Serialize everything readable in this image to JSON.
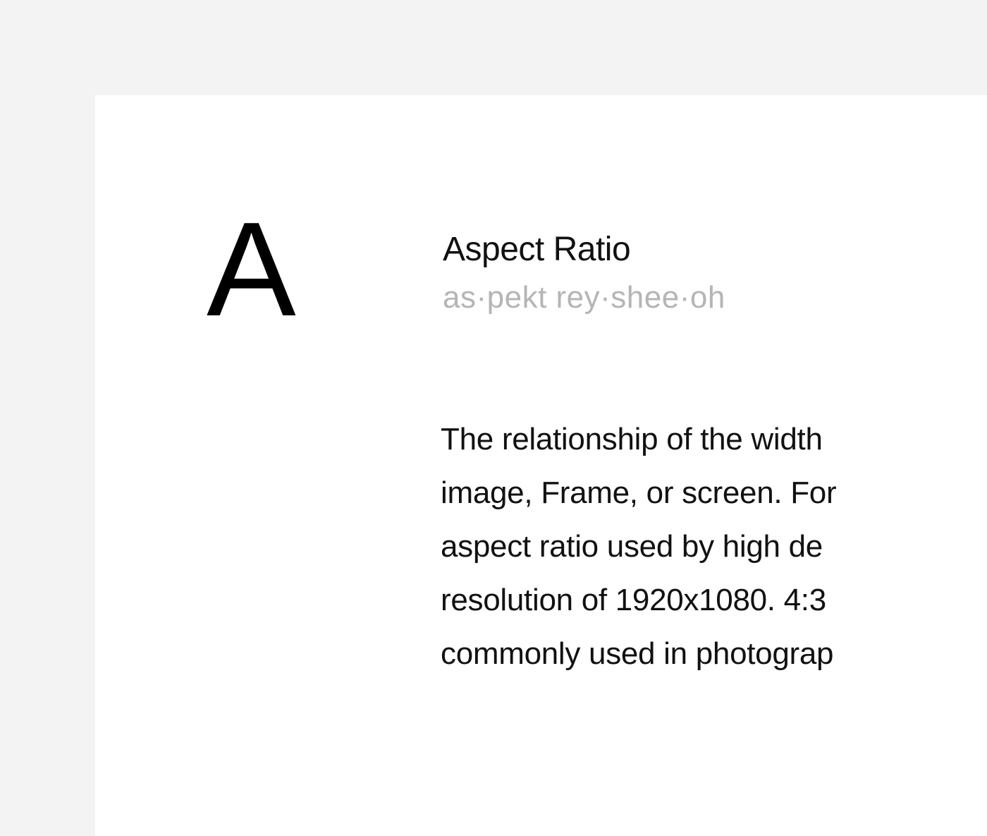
{
  "entry": {
    "letter": "A",
    "term": "Aspect Ratio",
    "pronunciation": "as·pekt rey·shee·oh",
    "definition": "The relationship of the width\nimage, Frame, or screen. For\naspect ratio used by high de\nresolution of 1920x1080. 4:3\ncommonly used in photograp"
  }
}
